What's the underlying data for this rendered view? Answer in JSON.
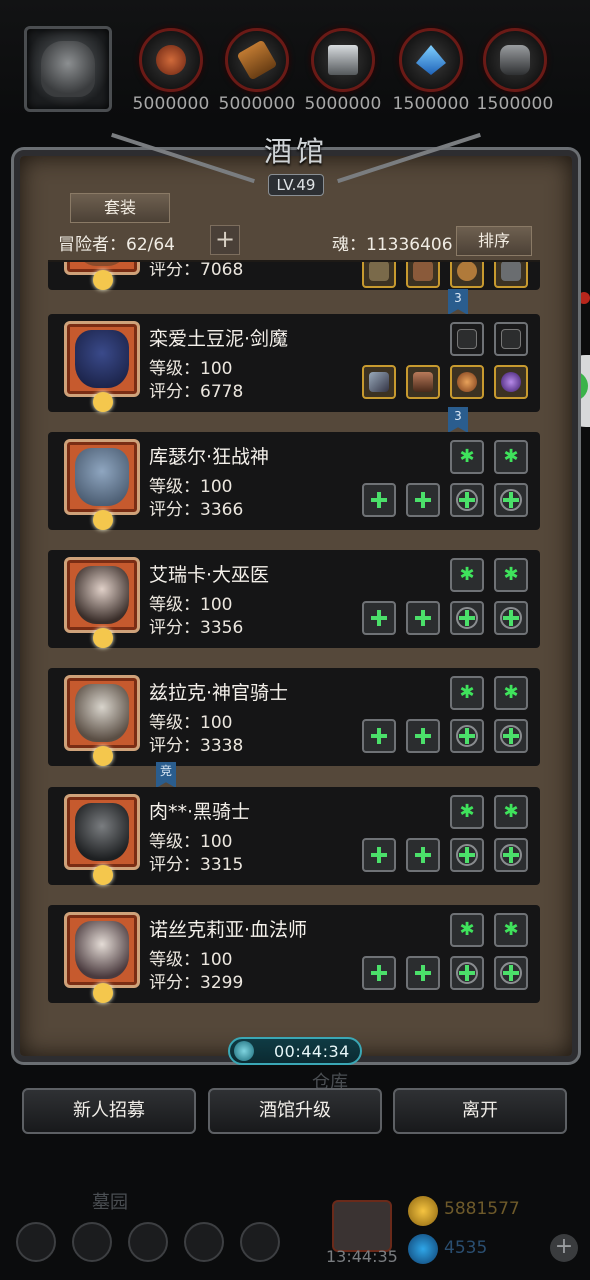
{
  "resources": [
    {
      "name": "meat",
      "amount": "5000000",
      "icon": "meat-icon",
      "color": "#b04a2a"
    },
    {
      "name": "wood",
      "amount": "5000000",
      "icon": "wood-icon",
      "color": "#a8672c"
    },
    {
      "name": "iron",
      "amount": "5000000",
      "icon": "iron-ingot-icon",
      "color": "#9ea3a7"
    },
    {
      "name": "crystal",
      "amount": "1500000",
      "icon": "crystal-icon",
      "color": "#2f8fe0"
    },
    {
      "name": "ore",
      "amount": "1500000",
      "icon": "ore-icon",
      "color": "#6a6d70"
    }
  ],
  "panel": {
    "title": "酒馆",
    "level": "LV.49",
    "set_button": "套装",
    "adventurers": "冒险者：62/64",
    "add_button": "+",
    "soul": "魂：11336406",
    "sort_button": "排序"
  },
  "heroes": [
    {
      "name": "",
      "level": "",
      "score": "评分：7068",
      "partial": true,
      "rank": "3"
    },
    {
      "name": "栾爱土豆泥·剑魔",
      "level": "等级：100",
      "score": "评分：6778",
      "rank": "3"
    },
    {
      "name": "库瑟尔·狂战神",
      "level": "等级：100",
      "score": "评分：3366"
    },
    {
      "name": "艾瑞卡·大巫医",
      "level": "等级：100",
      "score": "评分：3356"
    },
    {
      "name": "兹拉克·神官骑士",
      "level": "等级：100",
      "score": "评分：3338",
      "rank": "竞"
    },
    {
      "name": "肉**·黑骑士",
      "level": "等级：100",
      "score": "评分：3315"
    },
    {
      "name": "诺丝克莉亚·血法师",
      "level": "等级：100",
      "score": "评分：3299"
    }
  ],
  "timer": "00:44:34",
  "buttons": {
    "recruit": "新人招募",
    "upgrade": "酒馆升级",
    "leave": "离开"
  },
  "background": {
    "warehouse": "仓库",
    "graveyard": "墓园",
    "gift_timer": "13:44:35",
    "gold": "5881577",
    "gems": "4535"
  }
}
